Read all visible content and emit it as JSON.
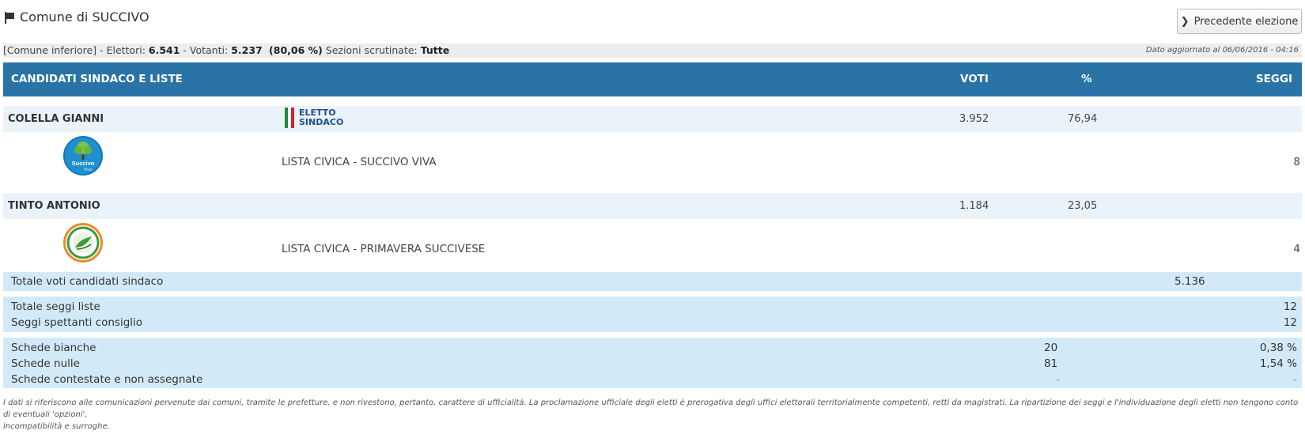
{
  "header": {
    "title": "Comune di SUCCIVO",
    "prev_button": "Precedente elezione"
  },
  "info": {
    "prefix": "[Comune inferiore] - Elettori: ",
    "elettori": "6.541",
    "mid": " - Votanti: ",
    "votanti": "5.237",
    "pct": " (80,06 %)",
    "sez_label": " Sezioni scrutinate: ",
    "sezioni": "Tutte",
    "updated": "Dato aggiornato al 06/06/2016 - 04:16"
  },
  "columns": {
    "candidati": "CANDIDATI SINDACO E LISTE",
    "voti": "VOTI",
    "perc": "%",
    "seggi": "SEGGI"
  },
  "candidates": [
    {
      "name": "COLELLA GIANNI",
      "badge_line1": "ELETTO",
      "badge_line2": "SINDACO",
      "voti": "3.952",
      "perc": "76,94",
      "list_name": "LISTA CIVICA - SUCCIVO VIVA",
      "list_seggi": "8",
      "logo_text1": "Succivo",
      "logo_text2": "Viva"
    },
    {
      "name": "TINTO ANTONIO",
      "voti": "1.184",
      "perc": "23,05",
      "list_name": "LISTA CIVICA - PRIMAVERA SUCCIVESE",
      "list_seggi": "4"
    }
  ],
  "totals": {
    "voti_label": "Totale voti candidati sindaco",
    "voti_value": "5.136",
    "seggi_liste_label": "Totale seggi liste",
    "seggi_liste_value": "12",
    "seggi_consiglio_label": "Seggi spettanti consiglio",
    "seggi_consiglio_value": "12"
  },
  "schede": [
    {
      "label": "Schede bianche",
      "count": "20",
      "perc": "0,38 %"
    },
    {
      "label": "Schede nulle",
      "count": "81",
      "perc": "1,54 %"
    },
    {
      "label": "Schede contestate e non assegnate",
      "count": "-",
      "perc": "-"
    }
  ],
  "note_line1": "I dati si riferiscono alle comunicazioni pervenute dai comuni, tramite le prefetture, e non rivestono, pertanto, carattere di ufficialità. La proclamazione ufficiale degli eletti è prerogativa degli uffici elettorali territorialmente competenti, retti da magistrati. La ripartizione dei seggi e l'individuazione degli eletti non tengono conto di eventuali 'opzioni',",
  "note_line2": "incompatibilità e surroghe.",
  "colors": {
    "header_bg": "#2a73a7",
    "candidate_row_bg": "#eaf2fa",
    "summary_bg": "#d2eaf8",
    "badge_text": "#1e4f8a"
  }
}
